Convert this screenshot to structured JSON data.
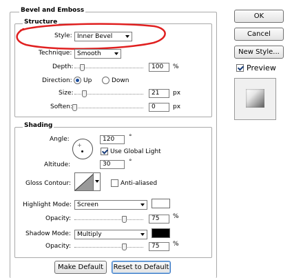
{
  "bevel": {
    "group_title": "Bevel and Emboss",
    "structure": {
      "title": "Structure",
      "style": {
        "label": "Style:",
        "value": "Inner Bevel"
      },
      "technique": {
        "label": "Technique:",
        "value": "Smooth"
      },
      "depth": {
        "label": "Depth:",
        "value": "100",
        "unit": "%",
        "slider_fraction": 0.1
      },
      "direction": {
        "label": "Direction:",
        "options": [
          "Up",
          "Down"
        ],
        "selected": "Up"
      },
      "size": {
        "label": "Size:",
        "value": "21",
        "unit": "px",
        "slider_fraction": 0.12
      },
      "soften": {
        "label": "Soften:",
        "value": "0",
        "unit": "px",
        "slider_fraction": 0.0
      }
    },
    "shading": {
      "title": "Shading",
      "angle": {
        "label": "Angle:",
        "value": "120",
        "unit": "°"
      },
      "use_global_light": {
        "label": "Use Global Light",
        "checked": true
      },
      "altitude": {
        "label": "Altitude:",
        "value": "30",
        "unit": "°"
      },
      "gloss_contour": {
        "label": "Gloss Contour:"
      },
      "anti_aliased": {
        "label": "Anti-aliased",
        "checked": false
      },
      "highlight_mode": {
        "label": "Highlight Mode:",
        "value": "Screen",
        "color": "#ffffff"
      },
      "highlight_opacity": {
        "label": "Opacity:",
        "value": "75",
        "unit": "%",
        "slider_fraction": 0.75
      },
      "shadow_mode": {
        "label": "Shadow Mode:",
        "value": "Multiply",
        "color": "#000000"
      },
      "shadow_opacity": {
        "label": "Opacity:",
        "value": "75",
        "unit": "%",
        "slider_fraction": 0.75
      }
    },
    "buttons": {
      "make_default": "Make Default",
      "reset_default": "Reset to Default"
    }
  },
  "side": {
    "ok": "OK",
    "cancel": "Cancel",
    "new_style": "New Style...",
    "preview": {
      "label": "Preview",
      "checked": true
    }
  },
  "colors": {
    "annotation_circle": "#e02020",
    "accent": "#3b78c4"
  }
}
